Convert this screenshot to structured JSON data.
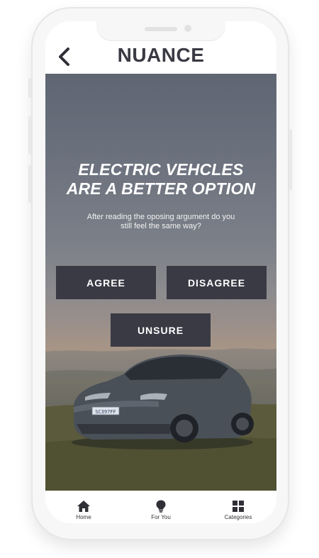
{
  "app": {
    "title": "NUANCE"
  },
  "hero": {
    "headline_line1": "ELECTRIC VEHCLES",
    "headline_line2": "ARE A BETTER OPTION",
    "prompt_line1": "After reading the oposing argument do you",
    "prompt_line2": "still feel the same way?",
    "license_plate": "SC397FF"
  },
  "choices": {
    "agree": "AGREE",
    "disagree": "DISAGREE",
    "unsure": "UNSURE"
  },
  "tabbar": {
    "items": [
      {
        "label": "Home",
        "icon": "home-icon"
      },
      {
        "label": "For You",
        "icon": "lightbulb-icon"
      },
      {
        "label": "Categories",
        "icon": "grid-icon"
      }
    ]
  },
  "colors": {
    "button_bg": "#3a3a44",
    "title_text": "#3a3a44",
    "phone_frame": "#f7f7f7"
  }
}
